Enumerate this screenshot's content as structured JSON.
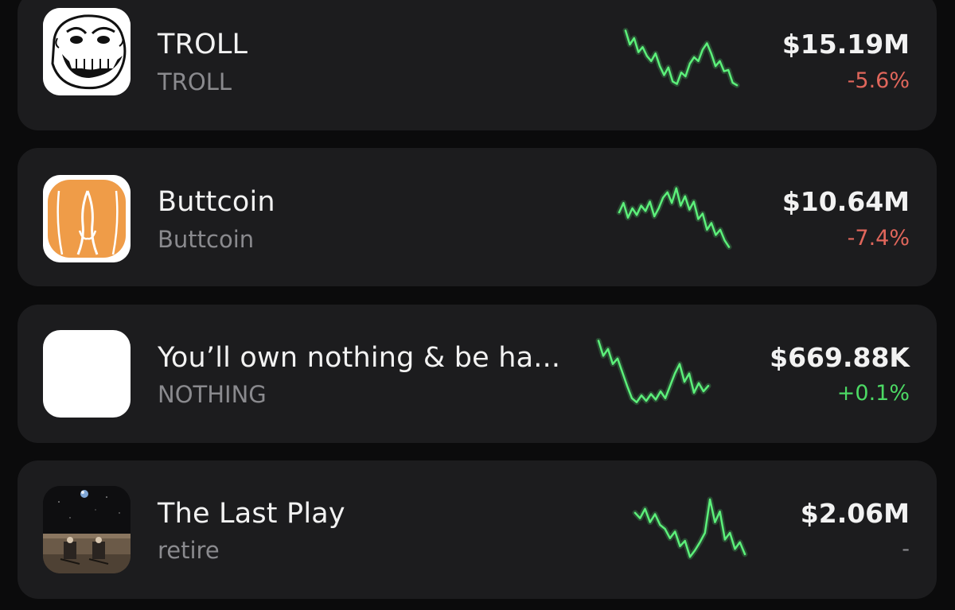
{
  "colors": {
    "background": "#0b0b0c",
    "card": "#1c1c1e",
    "primary_text": "#f2f2f2",
    "secondary_text": "#8a8a8e",
    "negative": "#e0665b",
    "positive": "#4cd964",
    "sparkline": "#5cf07a",
    "neutral": "#8a8a8e"
  },
  "tokens": [
    {
      "name": "TROLL",
      "ticker": "TROLL",
      "market_cap": "$15.19M",
      "change": "-5.6%",
      "change_direction": "negative",
      "icon": "trollface-icon",
      "sparkline": [
        0.92,
        0.7,
        0.8,
        0.58,
        0.66,
        0.52,
        0.44,
        0.56,
        0.36,
        0.22,
        0.34,
        0.12,
        0.08,
        0.26,
        0.2,
        0.4,
        0.5,
        0.44,
        0.62,
        0.72,
        0.56,
        0.36,
        0.44,
        0.28,
        0.3,
        0.1,
        0.06
      ]
    },
    {
      "name": "Buttcoin",
      "ticker": "Buttcoin",
      "market_cap": "$10.64M",
      "change": "-7.4%",
      "change_direction": "negative",
      "icon": "buttcoin-icon",
      "sparkline": [
        0.56,
        0.7,
        0.48,
        0.62,
        0.52,
        0.66,
        0.58,
        0.72,
        0.5,
        0.62,
        0.78,
        0.86,
        0.7,
        0.92,
        0.66,
        0.8,
        0.6,
        0.72,
        0.46,
        0.54,
        0.3,
        0.4,
        0.22,
        0.3,
        0.14,
        0.04
      ]
    },
    {
      "name": "You’ll own nothing & be ha...",
      "ticker": "NOTHING",
      "market_cap": "$669.88K",
      "change": "+0.1%",
      "change_direction": "positive",
      "icon": "blank-white-icon",
      "sparkline": [
        0.96,
        0.74,
        0.84,
        0.62,
        0.7,
        0.5,
        0.3,
        0.12,
        0.06,
        0.16,
        0.08,
        0.18,
        0.1,
        0.22,
        0.12,
        0.3,
        0.48,
        0.62,
        0.36,
        0.48,
        0.2,
        0.34,
        0.22,
        0.3
      ]
    },
    {
      "name": "The Last Play",
      "ticker": "retire",
      "market_cap": "$2.06M",
      "change": "-",
      "change_direction": "neutral",
      "icon": "moon-landscape-icon",
      "sparkline": [
        0.74,
        0.66,
        0.8,
        0.6,
        0.72,
        0.56,
        0.5,
        0.36,
        0.46,
        0.24,
        0.32,
        0.08,
        0.18,
        0.3,
        0.44,
        0.94,
        0.6,
        0.76,
        0.34,
        0.44,
        0.2,
        0.3,
        0.12
      ]
    }
  ]
}
